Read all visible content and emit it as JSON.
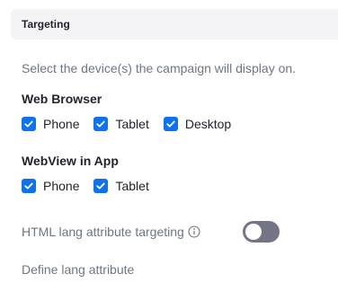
{
  "section": {
    "title": "Targeting"
  },
  "description": "Select the device(s) the campaign will display on.",
  "web_browser": {
    "title": "Web Browser",
    "options": [
      {
        "label": "Phone",
        "checked": true
      },
      {
        "label": "Tablet",
        "checked": true
      },
      {
        "label": "Desktop",
        "checked": true
      }
    ]
  },
  "webview": {
    "title": "WebView in App",
    "options": [
      {
        "label": "Phone",
        "checked": true
      },
      {
        "label": "Tablet",
        "checked": true
      }
    ]
  },
  "lang_targeting": {
    "label": "HTML lang attribute targeting",
    "icon": "info-icon",
    "enabled": false
  },
  "define_lang": {
    "label": "Define lang attribute"
  },
  "colors": {
    "accent": "#0e72ed",
    "toggle_off": "#747487",
    "header_bg": "#f4f4f6",
    "muted_text": "#6e7680"
  }
}
